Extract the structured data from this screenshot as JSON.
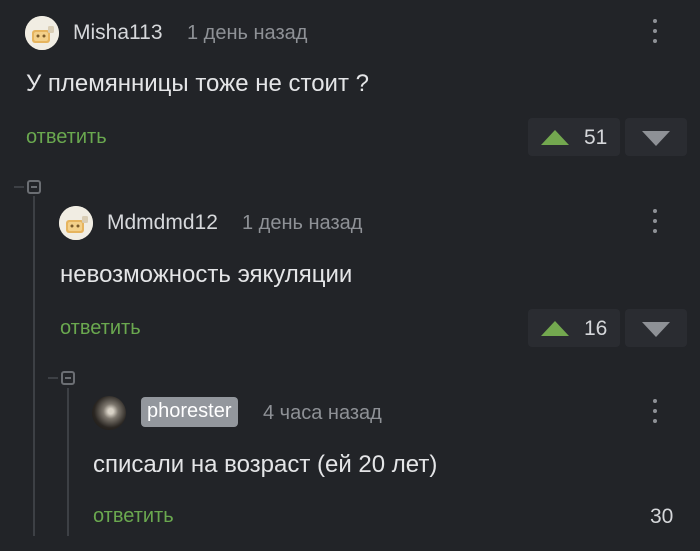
{
  "comments": [
    {
      "username": "Misha113",
      "time": "1 день назад",
      "text": "У племянницы тоже не стоит ?",
      "reply_label": "ответить",
      "score": "51"
    },
    {
      "username": "Mdmdmd12",
      "time": "1 день назад",
      "text": "невозможность эякуляции",
      "reply_label": "ответить",
      "score": "16"
    },
    {
      "username": "phorester",
      "time": "4 часа назад",
      "text": "списали на возраст (ей 20 лет)",
      "reply_label": "ответить",
      "score": "30"
    }
  ],
  "icons": {
    "more": "kebab-icon",
    "upvote": "upvote-arrow-icon",
    "downvote": "downvote-arrow-icon",
    "collapse": "collapse-thread-icon"
  },
  "colors": {
    "background": "#222428",
    "reply_link": "#6aa84f",
    "upvote": "#73a84f",
    "badge": "#93979d"
  }
}
